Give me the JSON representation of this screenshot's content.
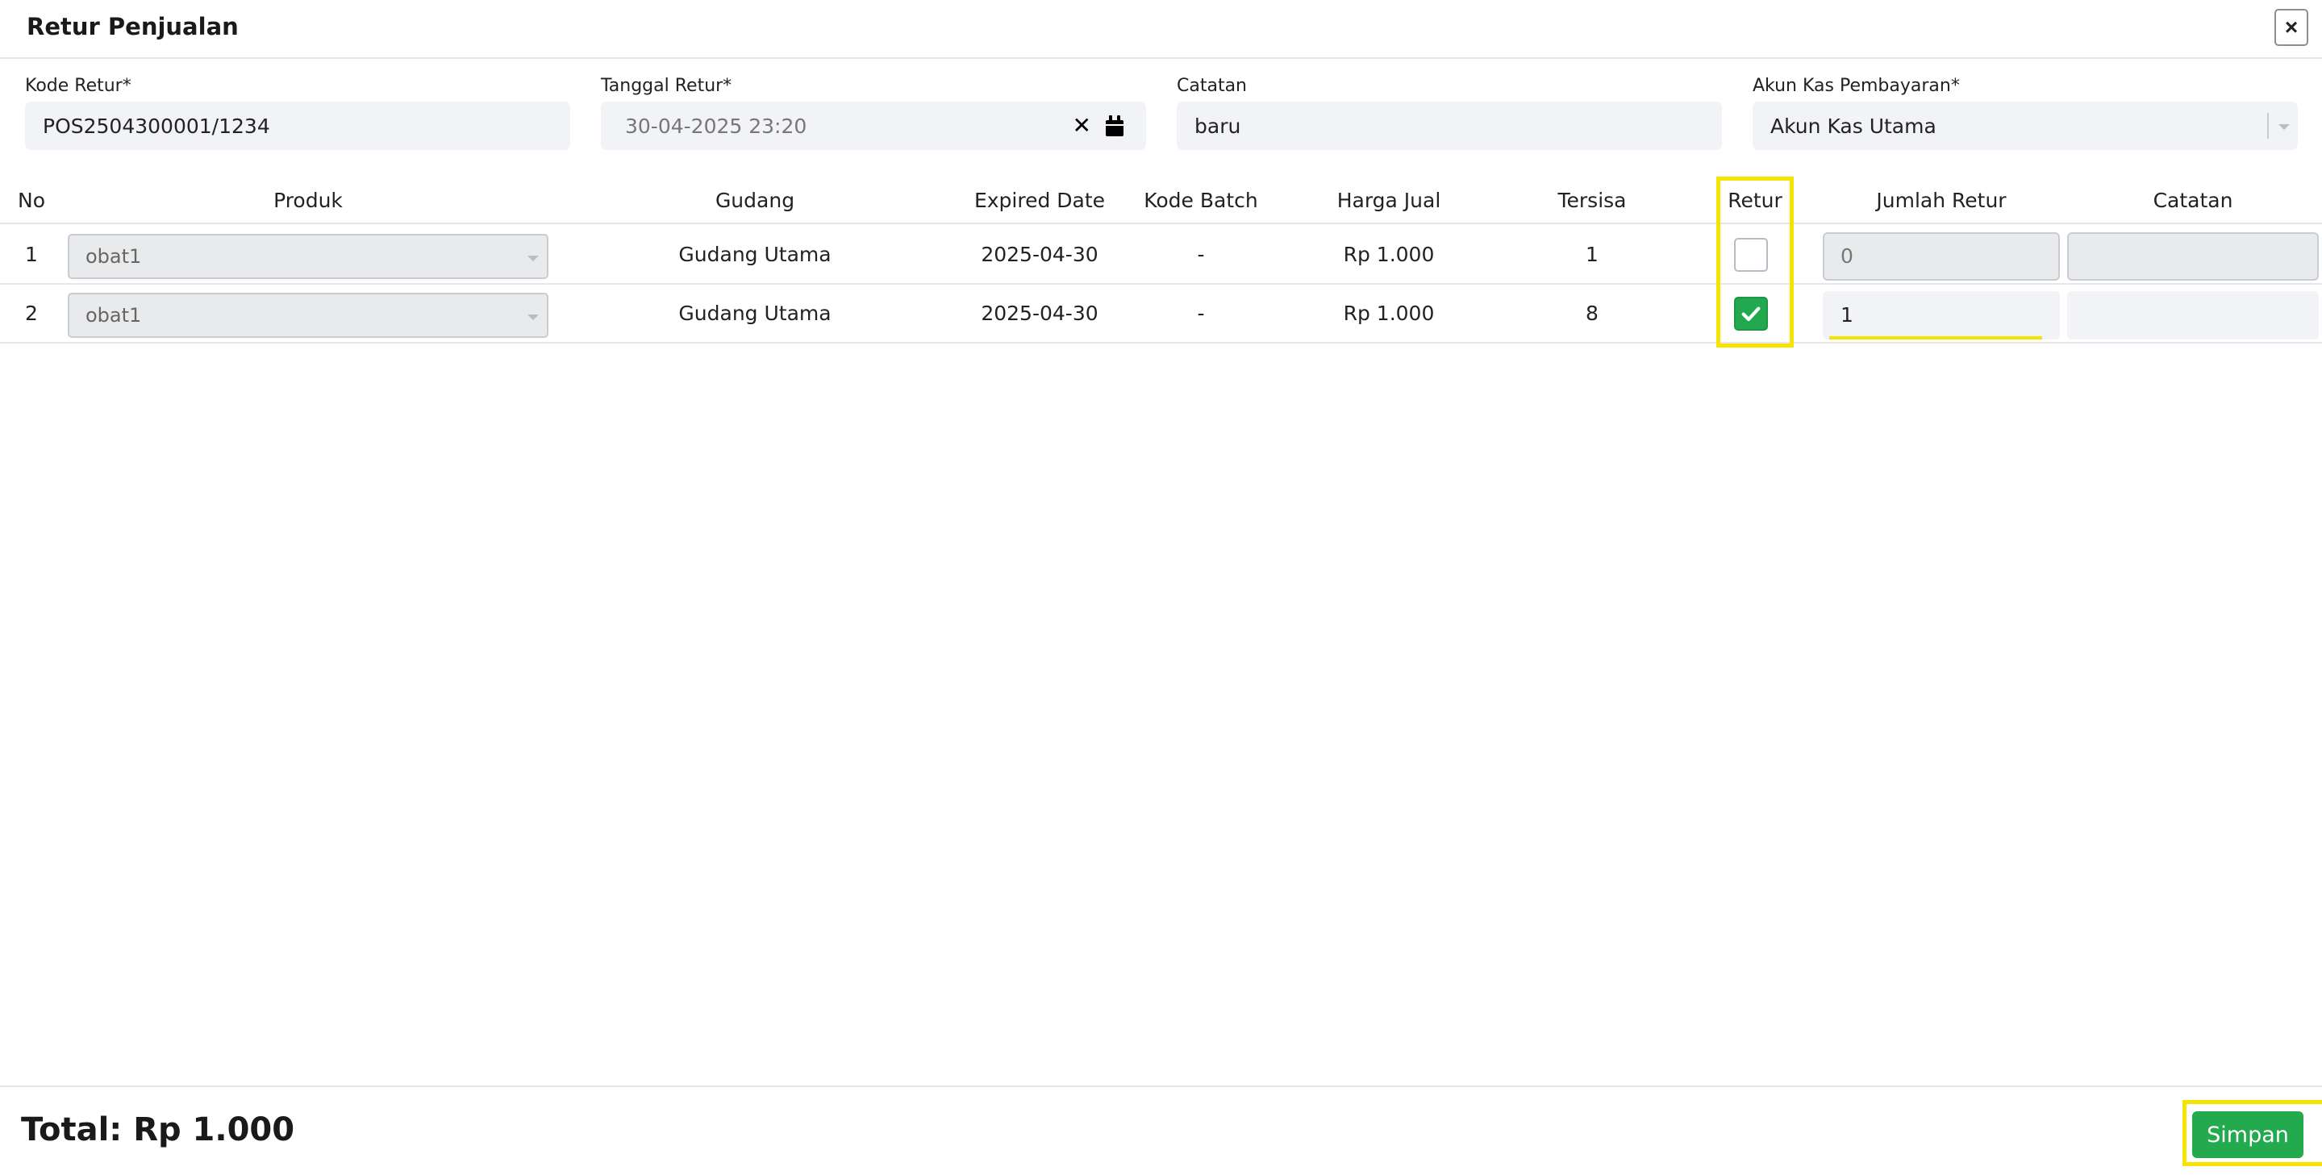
{
  "header": {
    "title": "Retur Penjualan",
    "close_label": "×"
  },
  "form": {
    "kode_retur": {
      "label": "Kode Retur*",
      "value": "POS2504300001/1234"
    },
    "tanggal_retur": {
      "label": "Tanggal Retur*",
      "value": "30-04-2025 23:20"
    },
    "catatan": {
      "label": "Catatan",
      "value": "baru"
    },
    "akun_kas": {
      "label": "Akun Kas Pembayaran*",
      "value": "Akun Kas Utama"
    }
  },
  "table": {
    "headers": {
      "no": "No",
      "produk": "Produk",
      "gudang": "Gudang",
      "expired": "Expired Date",
      "batch": "Kode Batch",
      "harga": "Harga Jual",
      "tersisa": "Tersisa",
      "retur": "Retur",
      "jumlah": "Jumlah Retur",
      "catatan": "Catatan"
    },
    "rows": [
      {
        "no": "1",
        "produk": "obat1",
        "gudang": "Gudang Utama",
        "expired": "2025-04-30",
        "batch": "-",
        "harga": "Rp 1.000",
        "tersisa": "1",
        "retur": false,
        "jumlah": "0",
        "catatan": ""
      },
      {
        "no": "2",
        "produk": "obat1",
        "gudang": "Gudang Utama",
        "expired": "2025-04-30",
        "batch": "-",
        "harga": "Rp 1.000",
        "tersisa": "8",
        "retur": true,
        "jumlah": "1",
        "catatan": ""
      }
    ]
  },
  "footer": {
    "total": "Total: Rp 1.000",
    "save_label": "Simpan"
  },
  "colors": {
    "accent_green": "#23a94e",
    "highlight_yellow": "#f5e300"
  }
}
